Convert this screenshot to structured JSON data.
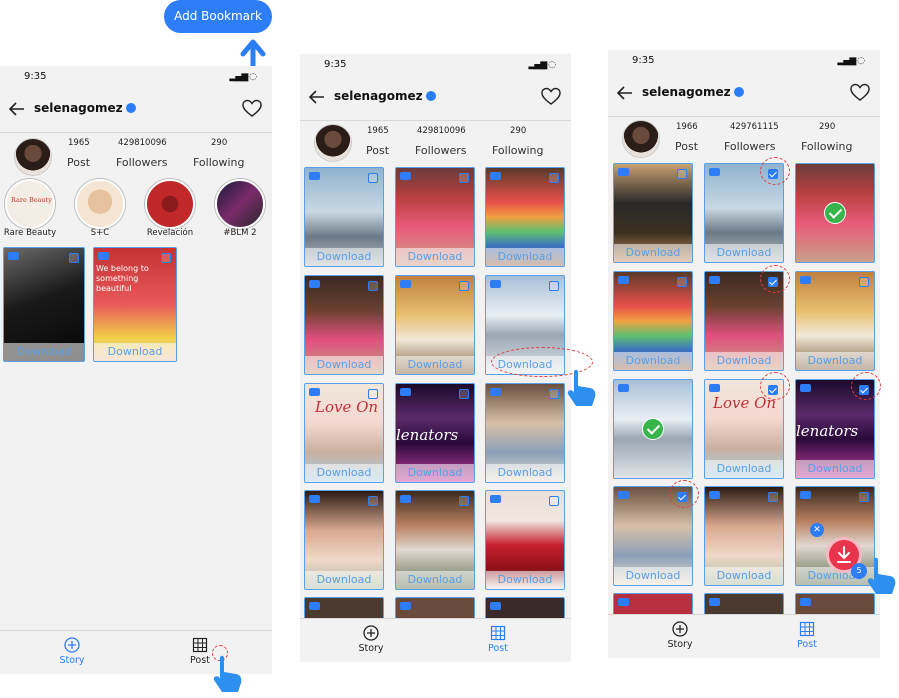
{
  "action_button": {
    "label": "Add Bookmark"
  },
  "screens": [
    {
      "time": "9:35",
      "username": "selenagomez",
      "stats": {
        "posts": "1965",
        "followers": "429810096",
        "following": "290"
      },
      "labels": {
        "post": "Post",
        "followers": "Followers",
        "following": "Following"
      },
      "stories": [
        "Rare Beauty",
        "S+C",
        "Revelación",
        "#BLM 2"
      ],
      "story_inner_text": "Rare Beauty",
      "tile_overlay_text": "We belong to something beautiful",
      "download_label": "Download",
      "tabs": {
        "story": "Story",
        "post": "Post"
      }
    },
    {
      "time": "9:35",
      "username": "selenagomez",
      "stats": {
        "posts": "1965",
        "followers": "429810096",
        "following": "290"
      },
      "labels": {
        "post": "Post",
        "followers": "Followers",
        "following": "Following"
      },
      "download_label": "Download",
      "tile_texts": {
        "love_on": "Love On",
        "lenators": "lenators"
      },
      "tabs": {
        "story": "Story",
        "post": "Post"
      }
    },
    {
      "time": "9:35",
      "username": "selenagomez",
      "stats": {
        "posts": "1966",
        "followers": "429761115",
        "following": "290"
      },
      "labels": {
        "post": "Post",
        "followers": "Followers",
        "following": "Following"
      },
      "download_label": "Download",
      "tile_texts": {
        "love_on": "Love On",
        "lenators": "lenators"
      },
      "selection_count": "5",
      "tabs": {
        "story": "Story",
        "post": "Post"
      }
    }
  ],
  "colors": {
    "accent": "#2d7df6",
    "download_text": "#5aa0e8",
    "success": "#38b54a",
    "fab": "#e8344c"
  },
  "icons": [
    "back-arrow-icon",
    "heart-icon",
    "verified-icon",
    "video-badge-icon",
    "checkbox-icon",
    "check-circle-icon",
    "download-icon",
    "plus-circle-icon",
    "grid-icon",
    "pointer-hand-icon"
  ]
}
